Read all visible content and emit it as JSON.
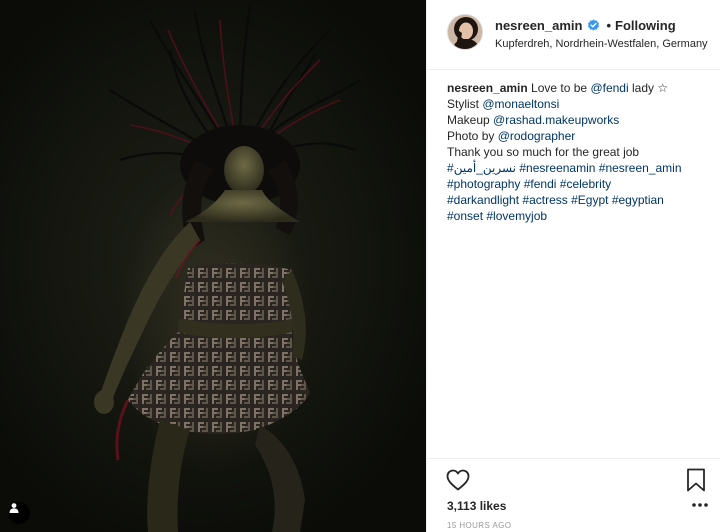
{
  "post": {
    "username": "nesreen_amin",
    "verified": true,
    "follow_status": "Following",
    "separator": "•",
    "location": "Kupferdreh, Nordrhein-Westfalen, Germany"
  },
  "caption": {
    "user": "nesreen_amin",
    "l1_text": " Love to be ",
    "l1_link": "@fendi",
    "l1_tail": " lady ☆",
    "l2_text": "Stylist ",
    "l2_link": "@monaeltonsi",
    "l3_text": "Makeup ",
    "l3_link": "@rashad.makeupworks",
    "l4_text": "Photo by ",
    "l4_link": "@rodographer",
    "l5_text": "Thank you so much for the great job",
    "l6_tag1": "#نسرين_أمين",
    "l6_tag2": "#nesreenamin",
    "l6_tag3": "#nesreen_amin",
    "l7_tag1": "#photography",
    "l7_tag2": "#fendi",
    "l7_tag3": "#celebrity",
    "l8_tag1": "#darkandlight",
    "l8_tag2": "#actress",
    "l8_tag3": "#Egypt",
    "l8_tag4": "#egyptian",
    "l9_tag1": "#onset",
    "l9_tag2": "#lovemyjob"
  },
  "engagement": {
    "likes": "3,113 likes",
    "timestamp": "15 HOURS AGO"
  },
  "icons": {
    "like": "heart-icon",
    "save": "bookmark-icon",
    "more": "more-options-icon",
    "verified": "verified-badge-icon",
    "user_tag": "user-tag-icon"
  },
  "colors": {
    "link": "#003569",
    "verified_badge": "#3897f0",
    "photo_red_light": "#7a1020"
  }
}
